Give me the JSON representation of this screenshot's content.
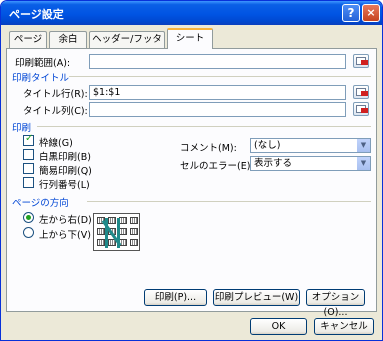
{
  "window": {
    "title": "ページ設定",
    "help_label": "?",
    "close_label": "×"
  },
  "tabs": [
    {
      "label": "ページ",
      "active": false
    },
    {
      "label": "余白",
      "active": false
    },
    {
      "label": "ヘッダー/フッター",
      "active": false
    },
    {
      "label": "シート",
      "active": true
    }
  ],
  "print_area": {
    "label": "印刷範囲(A):",
    "value": ""
  },
  "print_titles": {
    "section_label": "印刷タイトル",
    "rows_label": "タイトル行(R):",
    "rows_value": "$1:$1",
    "cols_label": "タイトル列(C):",
    "cols_value": ""
  },
  "print": {
    "section_label": "印刷",
    "gridlines": {
      "label": "枠線(G)",
      "checked": true
    },
    "black_white": {
      "label": "白黒印刷(B)",
      "checked": false
    },
    "draft": {
      "label": "簡易印刷(Q)",
      "checked": false
    },
    "row_col_headings": {
      "label": "行列番号(L)",
      "checked": false
    },
    "comments": {
      "label": "コメント(M):",
      "value": "(なし)"
    },
    "cell_errors": {
      "label": "セルのエラー(E):",
      "value": "表示する"
    }
  },
  "page_order": {
    "section_label": "ページの方向",
    "down_then_over": {
      "label": "左から右(D)",
      "selected": true
    },
    "over_then_down": {
      "label": "上から下(V)",
      "selected": false
    }
  },
  "buttons": {
    "print": "印刷(P)...",
    "print_preview": "印刷プレビュー(W)",
    "options": "オプション(O)...",
    "ok": "OK",
    "cancel": "キャンセル"
  },
  "colors": {
    "accent": "#0046d5",
    "titlebar": "#0054e3",
    "checked": "#21a121"
  }
}
